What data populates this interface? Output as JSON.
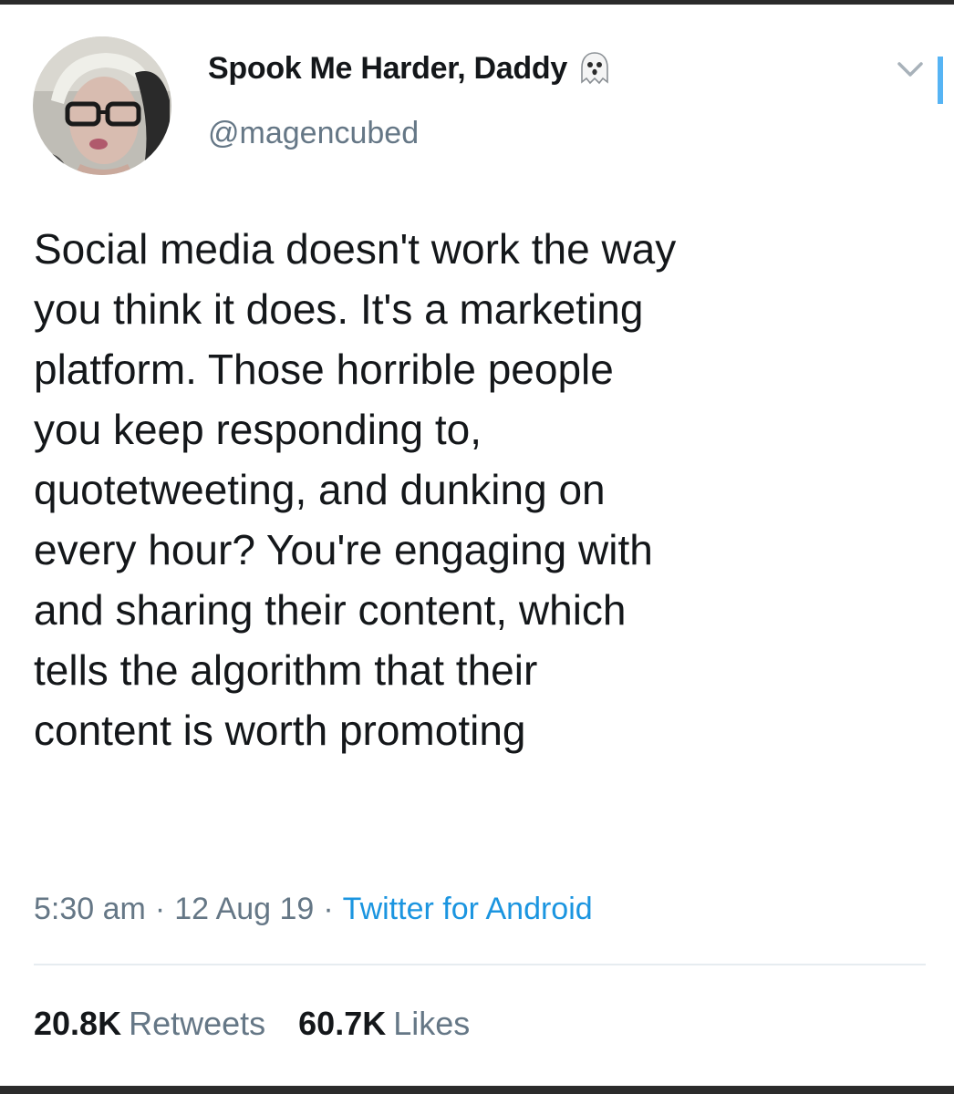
{
  "author": {
    "display_name": "Spook Me Harder, Daddy",
    "handle": "@magencubed",
    "name_emoji_icon": "ghost-icon",
    "avatar_icon": "profile-photo"
  },
  "tweet": {
    "lines": [
      "Social media doesn't work the way",
      "you think it does. It's a marketing",
      "platform. Those horrible people",
      "you keep responding to,",
      "quotetweeting, and dunking on",
      "every hour? You're engaging with",
      "and sharing their content, which",
      "tells the algorithm that their",
      "content is worth promoting"
    ],
    "time": "5:30 am",
    "date": "12 Aug 19",
    "source": "Twitter for Android",
    "separator": "·"
  },
  "stats": {
    "retweets_count": "20.8K",
    "retweets_label": "Retweets",
    "likes_count": "60.7K",
    "likes_label": "Likes"
  },
  "menu": {
    "caret_icon": "chevron-down-icon"
  },
  "colors": {
    "text_primary": "#14171a",
    "text_secondary": "#657786",
    "link": "#1b95e0",
    "divider": "#e6ecf0"
  }
}
